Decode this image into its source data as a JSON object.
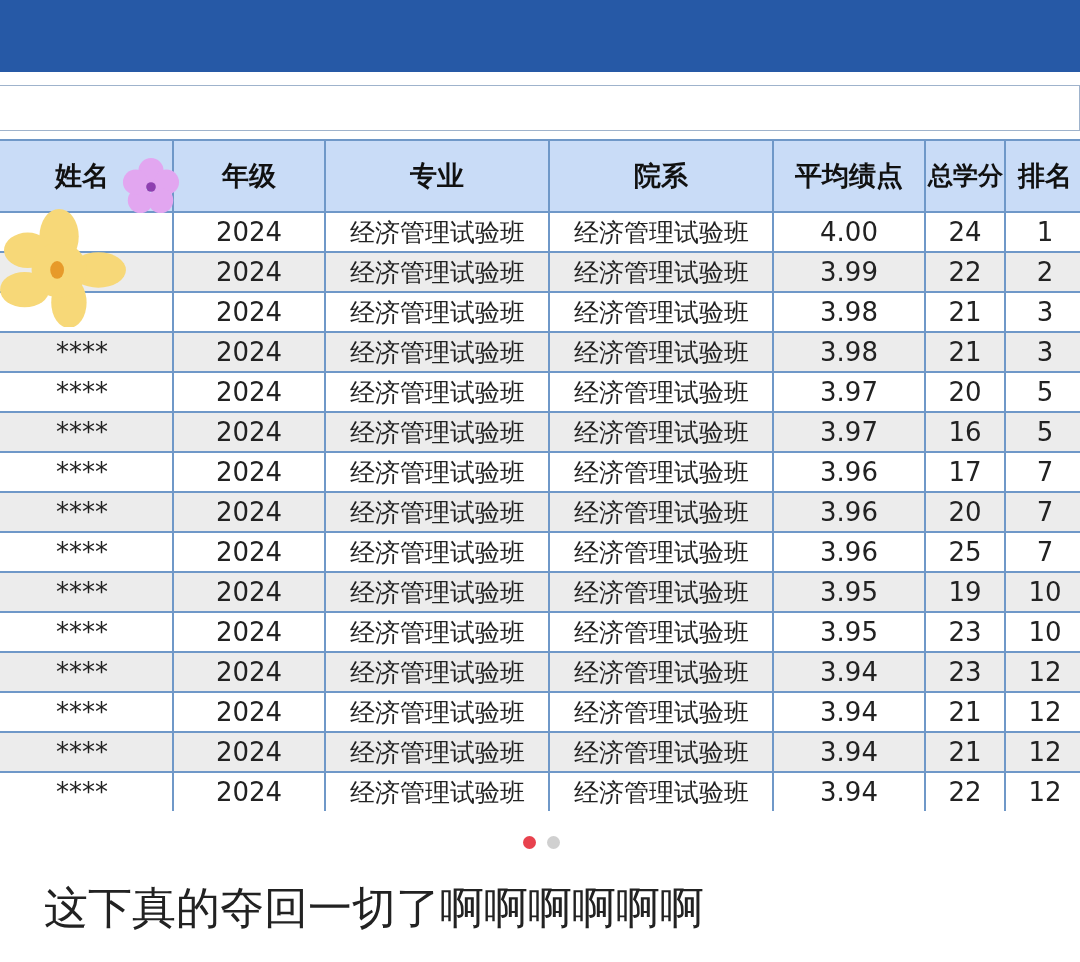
{
  "table": {
    "columns": [
      "姓名",
      "年级",
      "专业",
      "院系",
      "平均绩点",
      "总学分",
      "排名"
    ],
    "rows": [
      {
        "cells": [
          null,
          "2024",
          "经济管理试验班",
          "经济管理试验班",
          "4.00",
          "24",
          "1"
        ]
      },
      {
        "cells": [
          null,
          "2024",
          "经济管理试验班",
          "经济管理试验班",
          "3.99",
          "22",
          "2"
        ]
      },
      {
        "cells": [
          null,
          "2024",
          "经济管理试验班",
          "经济管理试验班",
          "3.98",
          "21",
          "3"
        ]
      },
      {
        "cells": [
          "****",
          "2024",
          "经济管理试验班",
          "经济管理试验班",
          "3.98",
          "21",
          "3"
        ]
      },
      {
        "cells": [
          "****",
          "2024",
          "经济管理试验班",
          "经济管理试验班",
          "3.97",
          "20",
          "5"
        ]
      },
      {
        "cells": [
          "****",
          "2024",
          "经济管理试验班",
          "经济管理试验班",
          "3.97",
          "16",
          "5"
        ]
      },
      {
        "cells": [
          "****",
          "2024",
          "经济管理试验班",
          "经济管理试验班",
          "3.96",
          "17",
          "7"
        ]
      },
      {
        "cells": [
          "****",
          "2024",
          "经济管理试验班",
          "经济管理试验班",
          "3.96",
          "20",
          "7"
        ]
      },
      {
        "cells": [
          "****",
          "2024",
          "经济管理试验班",
          "经济管理试验班",
          "3.96",
          "25",
          "7"
        ]
      },
      {
        "cells": [
          "****",
          "2024",
          "经济管理试验班",
          "经济管理试验班",
          "3.95",
          "19",
          "10"
        ]
      },
      {
        "cells": [
          "****",
          "2024",
          "经济管理试验班",
          "经济管理试验班",
          "3.95",
          "23",
          "10"
        ]
      },
      {
        "cells": [
          "****",
          "2024",
          "经济管理试验班",
          "经济管理试验班",
          "3.94",
          "23",
          "12"
        ]
      },
      {
        "cells": [
          "****",
          "2024",
          "经济管理试验班",
          "经济管理试验班",
          "3.94",
          "21",
          "12"
        ]
      },
      {
        "cells": [
          "****",
          "2024",
          "经济管理试验班",
          "经济管理试验班",
          "3.94",
          "21",
          "12"
        ]
      },
      {
        "cells": [
          "****",
          "2024",
          "经济管理试验班",
          "经济管理试验班",
          "3.94",
          "22",
          "12"
        ]
      }
    ]
  },
  "pager": [
    {
      "selected": true
    },
    {
      "selected": false
    }
  ],
  "caption": "这下真的夺回一切了啊啊啊啊啊啊"
}
